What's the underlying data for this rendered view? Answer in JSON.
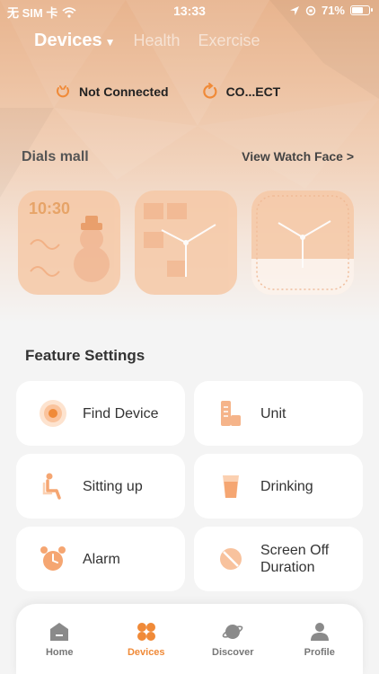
{
  "status_bar": {
    "carrier": "无 SIM 卡",
    "time": "13:33",
    "battery": "71%",
    "battery_level": 0.71
  },
  "tabs": [
    {
      "label": "Devices",
      "active": true
    },
    {
      "label": "Health",
      "active": false
    },
    {
      "label": "Exercise",
      "active": false
    }
  ],
  "connection": {
    "status_label": "Not Connected",
    "connect_label": "CO...ECT"
  },
  "dials": {
    "title": "Dials mall",
    "link": "View Watch Face >",
    "faces": [
      {
        "time": "10:30",
        "icon": "snowman-face"
      },
      {
        "icon": "analog-face"
      },
      {
        "icon": "analog-face-white"
      }
    ]
  },
  "features": {
    "title": "Feature Settings",
    "items": [
      {
        "label": "Find Device",
        "icon": "find-device-icon"
      },
      {
        "label": "Unit",
        "icon": "unit-icon"
      },
      {
        "label": "Sitting up",
        "icon": "sitting-icon"
      },
      {
        "label": "Drinking",
        "icon": "drinking-icon"
      },
      {
        "label": "Alarm",
        "icon": "alarm-icon"
      },
      {
        "label": "Screen Off Duration",
        "icon": "screen-off-icon"
      }
    ]
  },
  "tabbar": {
    "items": [
      {
        "label": "Home",
        "icon": "home-icon",
        "active": false
      },
      {
        "label": "Devices",
        "icon": "devices-icon",
        "active": true
      },
      {
        "label": "Discover",
        "icon": "planet-icon",
        "active": false
      },
      {
        "label": "Profile",
        "icon": "profile-icon",
        "active": false
      }
    ]
  },
  "colors": {
    "accent": "#f08a38",
    "card_icon": "#f5a672",
    "hero_top": "#e8b48e"
  }
}
